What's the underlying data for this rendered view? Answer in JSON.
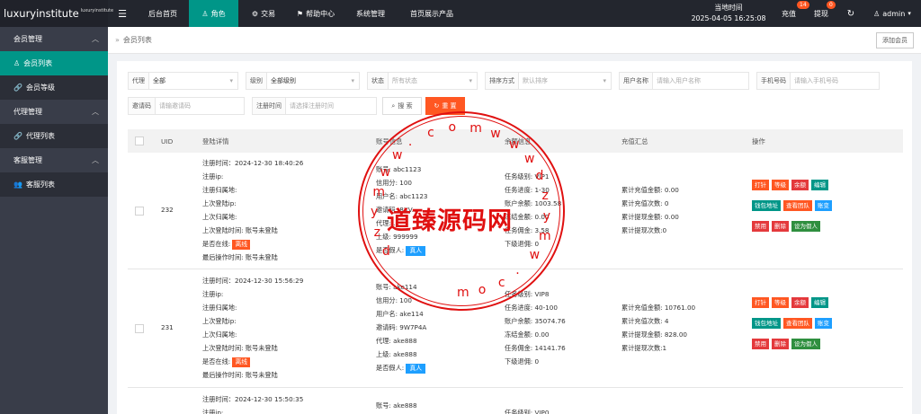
{
  "app": {
    "logo_main": "luxuryinstitute",
    "logo_small": "luxuryinstitute",
    "nav": [
      "后台首页",
      "角色",
      "交易",
      "帮助中心",
      "系统管理",
      "首页展示产品"
    ],
    "clock_label": "当地时间",
    "clock_value": "2025-04-05 16:25:08",
    "recharge_label": "充值",
    "recharge_count": "14",
    "withdraw_label": "提现",
    "withdraw_count": "0",
    "user": "admin",
    "accent": "#009688"
  },
  "sidebar": {
    "groups": [
      {
        "label": "会员管理",
        "items": [
          "会员列表",
          "会员等级"
        ]
      },
      {
        "label": "代理管理",
        "items": [
          "代理列表"
        ]
      },
      {
        "label": "客服管理",
        "items": [
          "客服列表"
        ]
      }
    ]
  },
  "breadcrumb": "会员列表",
  "add_button": "添加会员",
  "filters": {
    "agent_label": "代理",
    "agent_value": "全部",
    "level_label": "级别",
    "level_value": "全部级别",
    "status_label": "状态",
    "status_placeholder": "所有状态",
    "sort_label": "排序方式",
    "sort_placeholder": "默认排序",
    "username_label": "用户名称",
    "username_placeholder": "请输入用户名称",
    "phone_label": "手机号码",
    "phone_placeholder": "请输入手机号码",
    "invite_label": "邀请码",
    "invite_placeholder": "请输邀请码",
    "regtime_label": "注册时间",
    "regtime_placeholder": "请选择注册时间",
    "search_button": "搜 索",
    "reset_button": "重 置"
  },
  "table": {
    "headers": [
      "UID",
      "登陆详情",
      "账号信息",
      "余额信息",
      "充值汇总",
      "操作"
    ],
    "rows": [
      {
        "uid": "232",
        "login": [
          "注册时间：2024-12-30 18:40:26",
          "注册ip:",
          "注册归属地:",
          "上次登陆ip:",
          "上次归属地:",
          "上次登陆时间: 账号未登陆",
          "是否在线:",
          "最后操作时间: 账号未登陆"
        ],
        "online": "离线",
        "account": [
          "账号: abc1123",
          "信用分: 100",
          "用户名: abc1123",
          "邀请码: 8XV...",
          "代理: ...",
          "上级: 999999",
          "是否假人:"
        ],
        "fake": "真人",
        "balance": [
          "任务级别: VIP1",
          "任务进度: 1-30",
          "账户余额: 1003.58",
          "冻结金额: 0.00",
          "任务佣金: 3.58",
          "下级退佣: 0"
        ],
        "recharge": [
          "累计充值金额: 0.00",
          "累计充值次数: 0",
          "累计提现金额: 0.00",
          "累计提现次数:0"
        ]
      },
      {
        "uid": "231",
        "login": [
          "注册时间：2024-12-30 15:56:29",
          "注册ip:",
          "注册归属地:",
          "上次登陆ip:",
          "上次归属地:",
          "上次登陆时间: 账号未登陆",
          "是否在线:",
          "最后操作时间: 账号未登陆"
        ],
        "online": "离线",
        "account": [
          "账号: ake114",
          "信用分: 100",
          "用户名: ake114",
          "邀请码: 9W7P4A",
          "代理: ake888",
          "上级: ake888",
          "是否假人:"
        ],
        "fake": "真人",
        "balance": [
          "任务级别: VIP8",
          "任务进度: 40-100",
          "账户余额: 35074.76",
          "冻结金额: 0.00",
          "任务佣金: 14141.76",
          "下级退佣: 0"
        ],
        "recharge": [
          "累计充值金额: 10761.00",
          "累计充值次数: 4",
          "累计提现金额: 828.00",
          "累计提现次数:1"
        ]
      },
      {
        "uid": "",
        "login": [
          "注册时间：2024-12-30 15:50:35",
          "注册ip:"
        ],
        "account": [
          "账号: ake888"
        ],
        "balance": [
          "任务级别: VIP0"
        ]
      }
    ],
    "ops": {
      "row1": [
        "打针",
        "等级",
        "余额",
        "编辑"
      ],
      "row2": [
        "钱包地址",
        "查看团队",
        "账变"
      ],
      "row3": [
        "禁用",
        "删除",
        "设为假人"
      ]
    }
  },
  "watermark": {
    "ring_letters": [
      "d",
      "z",
      "y",
      "m",
      "w",
      "w",
      ".",
      "c",
      "o",
      "m",
      "w",
      "w",
      "w",
      "d",
      "z",
      "y",
      "m",
      "w",
      ".",
      "c",
      "o",
      "m"
    ],
    "center_text": "道臻源码网"
  }
}
